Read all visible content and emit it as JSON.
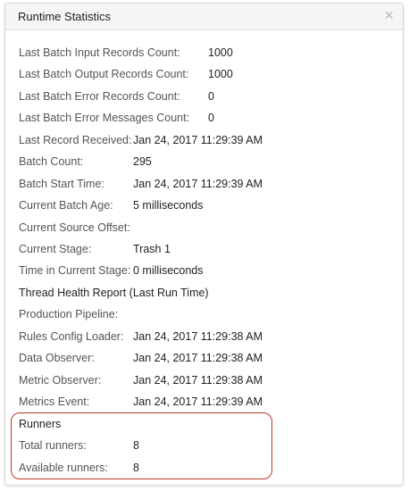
{
  "panel": {
    "title": "Runtime Statistics",
    "close_symbol": "×",
    "close_icon": "close-icon",
    "highlight_color": "#c0392b"
  },
  "stats": [
    {
      "label": "Last Batch Input Records Count:",
      "value": "1000"
    },
    {
      "label": "Last Batch Output Records Count:",
      "value": "1000"
    },
    {
      "label": "Last Batch Error Records Count:",
      "value": "0"
    },
    {
      "label": "Last Batch Error Messages Count:",
      "value": "0"
    },
    {
      "label": "Last Record Received:",
      "value": "Jan 24, 2017 11:29:39 AM"
    },
    {
      "label": "Batch Count:",
      "value": "295"
    },
    {
      "label": "Batch Start Time:",
      "value": "Jan 24, 2017 11:29:39 AM"
    },
    {
      "label": "Current Batch Age:",
      "value": "5 milliseconds"
    },
    {
      "label": "Current Source Offset:",
      "value": ""
    },
    {
      "label": "Current Stage:",
      "value": "Trash 1"
    },
    {
      "label": "Time in Current Stage:",
      "value": "0 milliseconds"
    }
  ],
  "thread_health": {
    "heading": "Thread Health Report (Last Run Time)",
    "items": [
      {
        "label": "Production Pipeline:",
        "value": ""
      },
      {
        "label": "Rules Config Loader:",
        "value": "Jan 24, 2017 11:29:38 AM"
      },
      {
        "label": "Data Observer:",
        "value": "Jan 24, 2017 11:29:38 AM"
      },
      {
        "label": "Metric Observer:",
        "value": "Jan 24, 2017 11:29:38 AM"
      },
      {
        "label": "Metrics Event:",
        "value": "Jan 24, 2017 11:29:39 AM"
      }
    ]
  },
  "runners": {
    "heading": "Runners",
    "items": [
      {
        "label": "Total runners:",
        "value": "8"
      },
      {
        "label": "Available runners:",
        "value": "8"
      }
    ]
  }
}
